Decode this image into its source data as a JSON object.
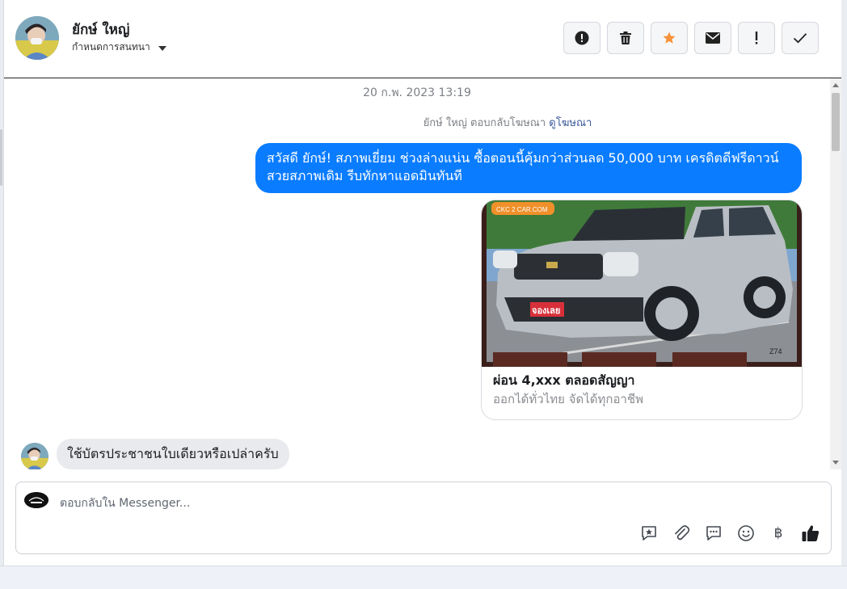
{
  "header": {
    "contact_name": "ยักษ์ ใหญ่",
    "label_action": "กำหนดการสนทนา",
    "actions": [
      {
        "icon": "alert-circle-icon"
      },
      {
        "icon": "trash-icon"
      },
      {
        "icon": "star-icon",
        "color": "#f7923a"
      },
      {
        "icon": "mail-icon"
      },
      {
        "icon": "exclamation-icon"
      },
      {
        "icon": "checkmark-icon"
      }
    ]
  },
  "thread": {
    "timestamp": "20 ก.พ. 2023 13:19",
    "ad_reply_text": "ยักษ์ ใหญ่ ตอบกลับโฆษณา",
    "ad_reply_link": "ดูโฆษณา",
    "outgoing_message": "สวัสดี ยักษ์!  สภาพเยี่ยม ช่วงล่างแน่น  ซื้อตอนนี้คุ้มกว่าส่วนลด 50,000 บาท เครดิตดีฟรีดาวน์  สวยสภาพเดิม รีบทักหาแอดมินทันที",
    "ad_card": {
      "image_logo_text": "CKC 2 CAR.COM",
      "image_sticker_text": "จองเลย",
      "image_code": "Z74",
      "title": "ผ่อน 4,xxx ตลอดสัญญา",
      "subtitle": "ออกได้ทั่วไทย จัดได้ทุกอาชีพ"
    },
    "incoming_message": "ใช้บัตรประชาชนใบเดียวหรือเปล่าครับ"
  },
  "composer": {
    "placeholder": "ตอบกลับใน Messenger...",
    "tools": [
      "saved-reply-icon",
      "attachment-icon",
      "chat-bubble-icon",
      "emoji-icon",
      "baht-icon",
      "thumbs-up-icon"
    ],
    "baht_symbol": "฿"
  },
  "colors": {
    "outgoing_bubble": "#0a7cff",
    "incoming_bubble": "#e9eaed",
    "star": "#f7923a"
  }
}
